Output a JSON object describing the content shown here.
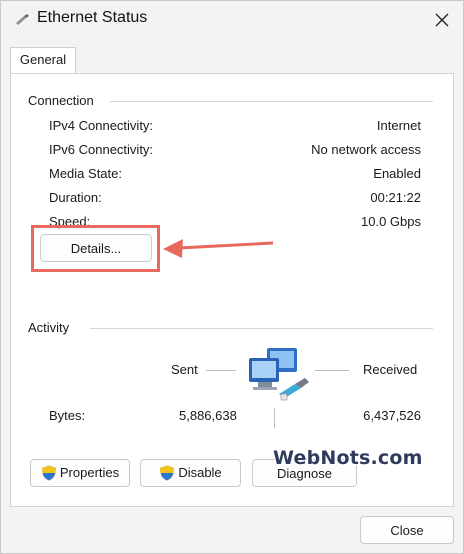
{
  "window": {
    "title": "Ethernet Status",
    "title_icon": "network-adapter-icon",
    "close_icon": "close-icon"
  },
  "tabs": [
    {
      "label": "General",
      "selected": true
    }
  ],
  "connection": {
    "heading": "Connection",
    "rows": [
      {
        "label": "IPv4 Connectivity:",
        "value": "Internet"
      },
      {
        "label": "IPv6 Connectivity:",
        "value": "No network access"
      },
      {
        "label": "Media State:",
        "value": "Enabled"
      },
      {
        "label": "Duration:",
        "value": "00:21:22"
      },
      {
        "label": "Speed:",
        "value": "10.0 Gbps"
      }
    ],
    "details_label": "Details..."
  },
  "activity": {
    "heading": "Activity",
    "sent_label": "Sent",
    "received_label": "Received",
    "bytes_label": "Bytes:",
    "bytes_sent": "5,886,638",
    "bytes_received": "6,437,526",
    "icon": "network-computers-icon"
  },
  "actions": {
    "properties_label": "Properties",
    "disable_label": "Disable",
    "diagnose_label": "Diagnose",
    "shield_icon": "uac-shield-icon"
  },
  "footer": {
    "close_label": "Close"
  },
  "watermark": "WebNots.com",
  "colors": {
    "highlight": "#e8685c",
    "window_bg": "#f3f3f3",
    "panel_bg": "#ffffff"
  }
}
